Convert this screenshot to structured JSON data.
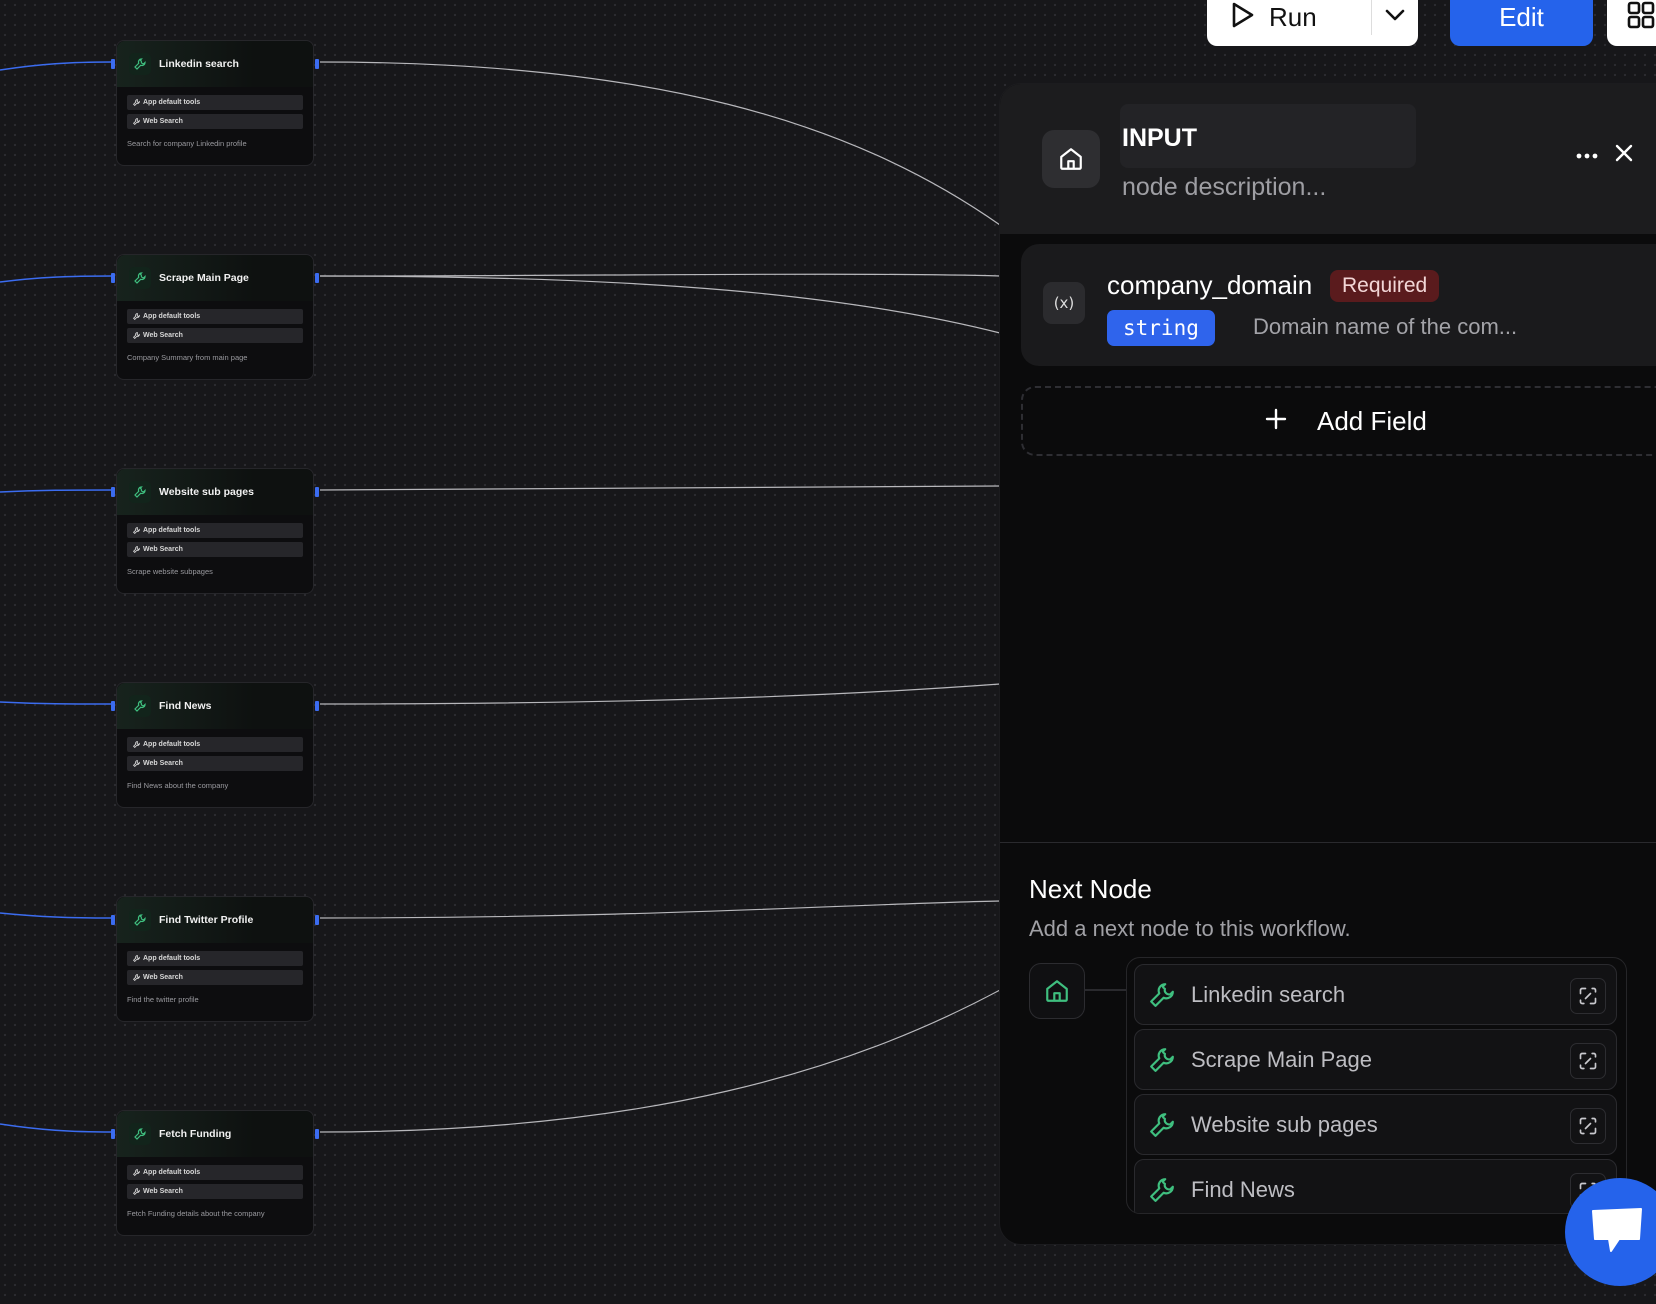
{
  "toolbar": {
    "run_label": "Run",
    "edit_label": "Edit"
  },
  "nodes": [
    {
      "title": "Linkedin search",
      "tools": [
        "App default tools",
        "Web Search"
      ],
      "description": "Search for company Linkedin profile"
    },
    {
      "title": "Scrape Main Page",
      "tools": [
        "App default tools",
        "Web Search"
      ],
      "description": "Company Summary from main page"
    },
    {
      "title": "Website sub pages",
      "tools": [
        "App default tools",
        "Web Search"
      ],
      "description": "Scrape website subpages"
    },
    {
      "title": "Find News",
      "tools": [
        "App default tools",
        "Web Search"
      ],
      "description": "Find News about the company"
    },
    {
      "title": "Find Twitter Profile",
      "tools": [
        "App default tools",
        "Web Search"
      ],
      "description": "Find the twitter profile"
    },
    {
      "title": "Fetch Funding",
      "tools": [
        "App default tools",
        "Web Search"
      ],
      "description": "Fetch Funding details about the company"
    }
  ],
  "panel": {
    "title": "INPUT",
    "description_placeholder": "node description...",
    "field": {
      "name": "company_domain",
      "required_label": "Required",
      "type": "string",
      "description": "Domain name of the com..."
    },
    "add_field_label": "Add Field",
    "next_node": {
      "title": "Next Node",
      "subtitle": "Add a next node to this workflow.",
      "items": [
        "Linkedin search",
        "Scrape Main Page",
        "Website sub pages",
        "Find News"
      ]
    }
  },
  "colors": {
    "accent": "#2563eb",
    "node_icon": "#3fbf7f",
    "required_bg": "#5a1b1d",
    "edge_in": "#3b6cf0",
    "edge_out": "#d4d4d8"
  },
  "icons": {
    "tool": "wrench-icon",
    "home": "home-icon",
    "variable": "variable-icon",
    "more": "more-icon",
    "close": "close-icon",
    "add": "plus-icon",
    "unlink": "unlink-icon",
    "chat": "chat-icon",
    "grid": "grid-icon",
    "play": "play-icon",
    "caret": "chevron-down-icon"
  }
}
